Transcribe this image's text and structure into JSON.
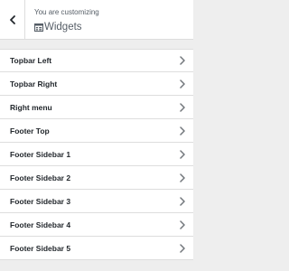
{
  "header": {
    "subtitle": "You are customizing",
    "title": "Widgets"
  },
  "sections": [
    {
      "label": "Topbar Left"
    },
    {
      "label": "Topbar Right"
    },
    {
      "label": "Right menu"
    },
    {
      "label": "Footer Top"
    },
    {
      "label": "Footer Sidebar 1"
    },
    {
      "label": "Footer Sidebar 2"
    },
    {
      "label": "Footer Sidebar 3"
    },
    {
      "label": "Footer Sidebar 4"
    },
    {
      "label": "Footer Sidebar 5"
    }
  ],
  "icons": {
    "back": "chevron-left-icon",
    "section": "widgets-icon",
    "expand": "chevron-right-icon"
  },
  "colors": {
    "panel_background": "#eeeeee",
    "item_background": "#ffffff",
    "border": "#dddddd",
    "text": "#23282d",
    "muted_text": "#555d66"
  }
}
